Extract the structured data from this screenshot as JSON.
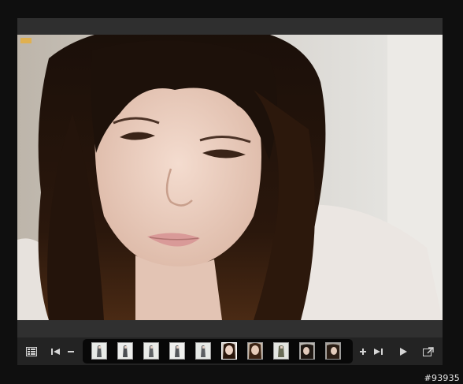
{
  "viewer": {
    "photo_subject": "portrait-photo",
    "thumbnails": [
      {
        "style": "light",
        "selected": false
      },
      {
        "style": "light",
        "selected": false
      },
      {
        "style": "light",
        "selected": false
      },
      {
        "style": "light",
        "selected": false
      },
      {
        "style": "light",
        "selected": false
      },
      {
        "style": "portrait",
        "selected": true
      },
      {
        "style": "portrait",
        "selected": false
      },
      {
        "style": "light",
        "selected": false
      },
      {
        "style": "darkhair",
        "selected": false
      },
      {
        "style": "darkhair",
        "selected": false
      }
    ],
    "icons": {
      "grid": "grid-icon",
      "first": "skip-to-first-icon",
      "zoom_out": "minus-icon",
      "zoom_in": "plus-icon",
      "last": "skip-to-last-icon",
      "play": "play-icon",
      "popout": "popout-icon"
    },
    "colors": {
      "frame": "#2b2b2b",
      "strip": "#080808",
      "icon": "#d6d6d6"
    }
  },
  "watermark": {
    "text": "#93935"
  }
}
